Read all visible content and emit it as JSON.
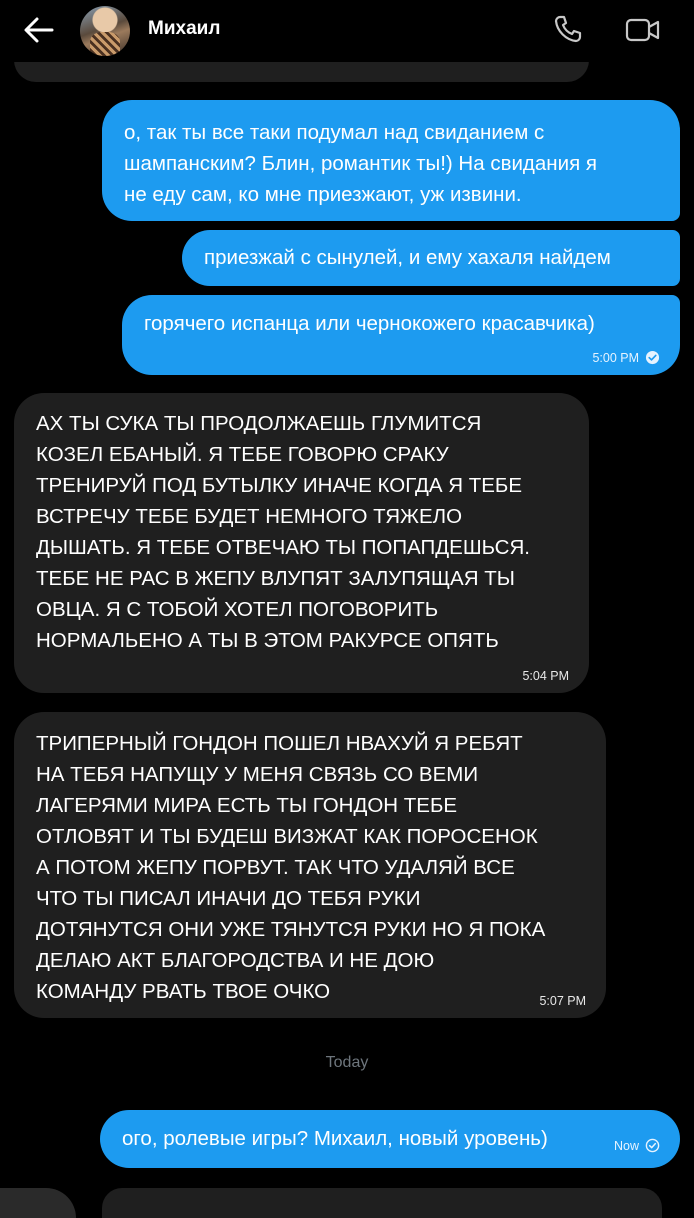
{
  "header": {
    "contact_name": "Михаил"
  },
  "divider": {
    "day_label": "Today"
  },
  "messages": [
    {
      "direction": "outgoing",
      "text": "о, так ты все таки подумал над свиданием с\nшампанским? Блин, романтик ты!) На свидания я\nне еду сам, ко мне приезжают, уж извини.",
      "time": ""
    },
    {
      "direction": "outgoing",
      "text": "приезжай с сынулей, и ему хахаля найдем",
      "time": ""
    },
    {
      "direction": "outgoing",
      "text": "горячего испанца или чернокожего красавчика)",
      "time": "5:00 PM",
      "status": "read"
    },
    {
      "direction": "incoming",
      "text": "АХ ТЫ СУКА ТЫ ПРОДОЛЖАЕШЬ ГЛУМИТСЯ\nКОЗЕЛ ЕБАНЫЙ. Я ТЕБЕ ГОВОРЮ СРАКУ\nТРЕНИРУЙ ПОД БУТЫЛКУ ИНАЧЕ КОГДА Я ТЕБЕ\nВСТРЕЧУ ТЕБЕ БУДЕТ НЕМНОГО ТЯЖЕЛО\nДЫШАТЬ. Я ТЕБЕ ОТВЕЧАЮ ТЫ ПОПАПДЕШЬСЯ.\nТЕБЕ НЕ РАС В ЖЕПУ ВЛУПЯТ ЗАЛУПЯЩАЯ ТЫ\nОВЦА. Я С ТОБОЙ ХОТЕЛ ПОГОВОРИТЬ\nНОРМАЛЬЕНО А ТЫ В ЭТОМ РАКУРСЕ ОПЯТЬ",
      "time": "5:04 PM"
    },
    {
      "direction": "incoming",
      "text": "ТРИПЕРНЫЙ ГОНДОН ПОШЕЛ НВАХУЙ Я РЕБЯТ\nНА ТЕБЯ НАПУЩУ У МЕНЯ СВЯЗЬ СО ВЕМИ\nЛАГЕРЯМИ МИРА ЕСТЬ ТЫ ГОНДОН ТЕБЕ\nОТЛОВЯТ И ТЫ БУДЕШ ВИЗЖАТ КАК ПОРОСЕНОК\nА ПОТОМ ЖЕПУ ПОРВУТ. ТАК ЧТО УДАЛЯЙ ВСЕ\nЧТО ТЫ ПИСАЛ ИНАЧИ ДО ТЕБЯ РУКИ\nДОТЯНУТСЯ ОНИ УЖЕ ТЯНУТСЯ РУКИ НО Я ПОКА\nДЕЛАЮ АКТ БЛАГОРОДСТВА И НЕ ДОЮ\nКОМАНДУ РВАТЬ ТВОЕ ОЧКО",
      "time": "5:07 PM"
    },
    {
      "direction": "outgoing",
      "text": "ого, ролевые игры? Михаил, новый уровень)",
      "time": "Now",
      "status": "read"
    }
  ],
  "icons": {
    "back": "arrow-left-icon",
    "call": "phone-icon",
    "video": "video-camera-icon",
    "read_status": "check-circle-icon"
  },
  "colors": {
    "background": "#000000",
    "outgoing_bubble": "#1d9bf0",
    "incoming_bubble": "#1f1f1f",
    "secondary_text": "#6e767d"
  }
}
